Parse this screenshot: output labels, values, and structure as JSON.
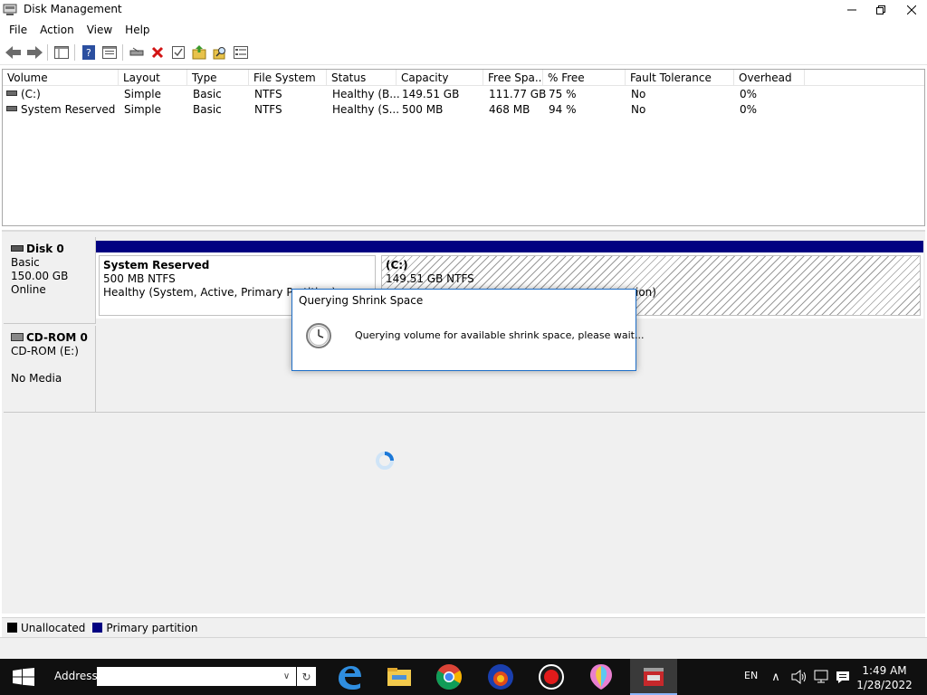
{
  "window": {
    "title": "Disk Management"
  },
  "menu": [
    "File",
    "Action",
    "View",
    "Help"
  ],
  "volume_list": {
    "columns": [
      "Volume",
      "Layout",
      "Type",
      "File System",
      "Status",
      "Capacity",
      "Free Spa...",
      "% Free",
      "Fault Tolerance",
      "Overhead"
    ],
    "rows": [
      {
        "volume": "(C:)",
        "layout": "Simple",
        "type": "Basic",
        "fs": "NTFS",
        "status": "Healthy (B...",
        "capacity": "149.51 GB",
        "free": "111.77 GB",
        "pct": "75 %",
        "fault": "No",
        "overhead": "0%"
      },
      {
        "volume": "System Reserved",
        "layout": "Simple",
        "type": "Basic",
        "fs": "NTFS",
        "status": "Healthy (S...",
        "capacity": "500 MB",
        "free": "468 MB",
        "pct": "94 %",
        "fault": "No",
        "overhead": "0%"
      }
    ]
  },
  "disks": {
    "disk0": {
      "name": "Disk 0",
      "type": "Basic",
      "size": "150.00 GB",
      "state": "Online"
    },
    "cdrom0": {
      "name": "CD-ROM 0",
      "drive": "CD-ROM (E:)",
      "media": "No Media"
    }
  },
  "partitions": {
    "system_reserved": {
      "name": "System Reserved",
      "size": "500 MB NTFS",
      "status": "Healthy (System, Active, Primary Partition)"
    },
    "c": {
      "name": "(C:)",
      "size": "149.51 GB NTFS",
      "status_tail": "ion)"
    }
  },
  "dialog": {
    "title": "Querying Shrink Space",
    "message": "Querying volume for available shrink space, please wait..."
  },
  "legend": {
    "unallocated": "Unallocated",
    "primary": "Primary partition"
  },
  "taskbar": {
    "address_label": "Address",
    "address_value": "",
    "lang": "EN",
    "time": "1:49 AM",
    "date": "1/28/2022"
  },
  "colors": {
    "primary_partition": "#010181",
    "unallocated": "#000000",
    "dialog_border": "#1f6fc8"
  }
}
